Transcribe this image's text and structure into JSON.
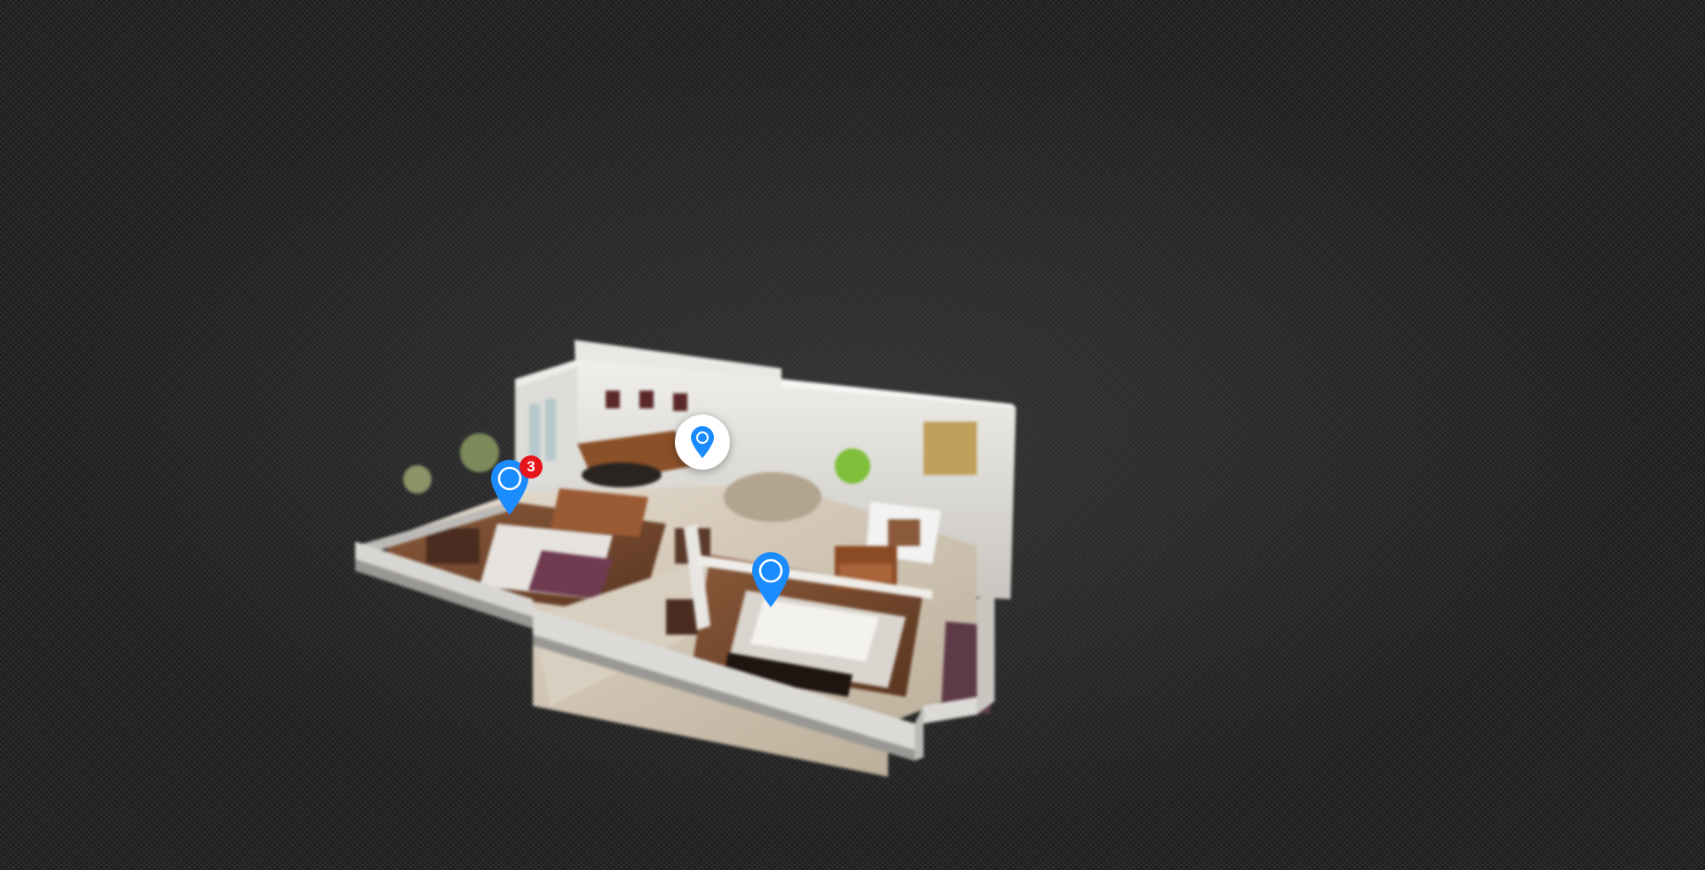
{
  "scene": {
    "background_color": "#1e1e1e",
    "pin_color": "#1a8cff",
    "badge_color": "#e8141c"
  },
  "hotspots": [
    {
      "id": "hotspot-bedroom-left",
      "badge": "3",
      "icon": "map-pin-icon"
    },
    {
      "id": "hotspot-living-room",
      "active": true,
      "icon": "map-pin-icon"
    },
    {
      "id": "hotspot-master-bedroom",
      "icon": "map-pin-icon"
    }
  ]
}
